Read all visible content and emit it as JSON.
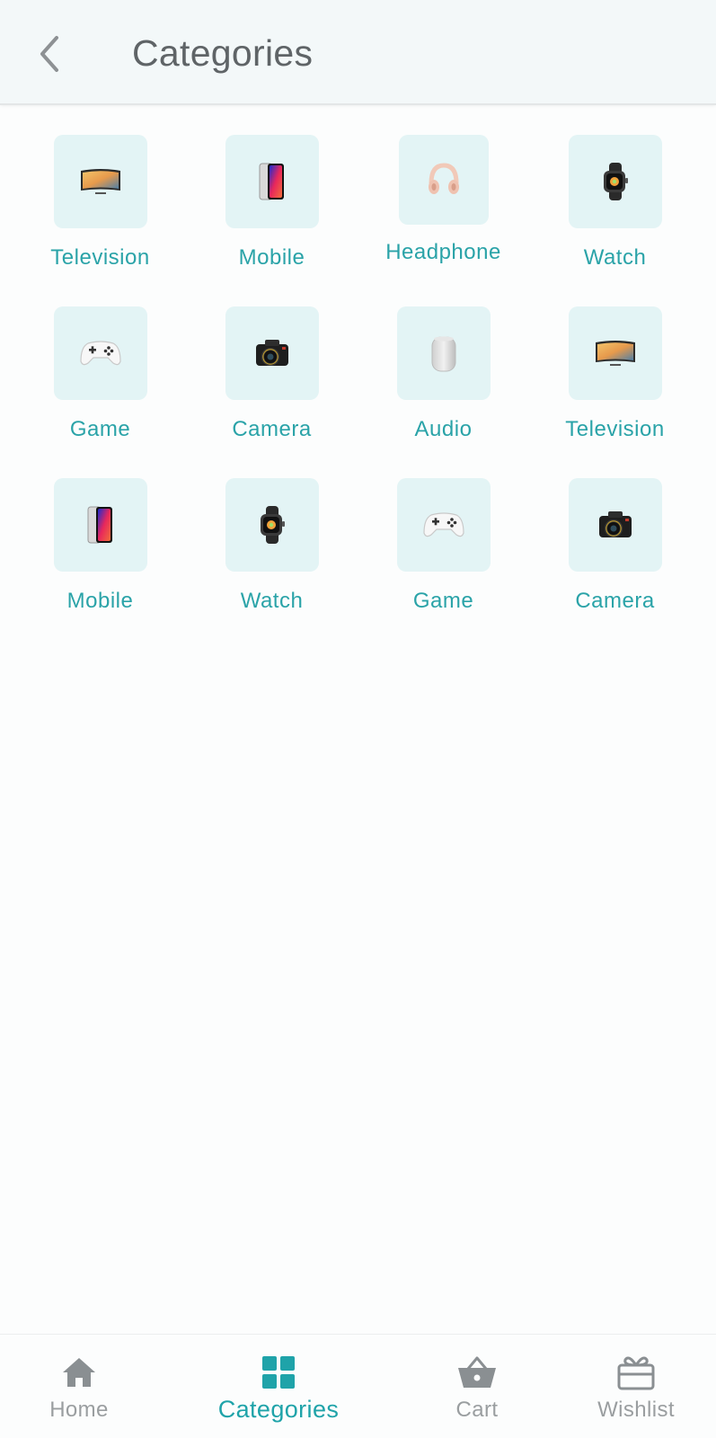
{
  "header": {
    "title": "Categories"
  },
  "categories": [
    {
      "label": "Television",
      "icon": "television-icon"
    },
    {
      "label": "Mobile",
      "icon": "mobile-icon"
    },
    {
      "label": "Headphone",
      "icon": "headphone-icon"
    },
    {
      "label": "Watch",
      "icon": "watch-icon"
    },
    {
      "label": "Game",
      "icon": "game-controller-icon"
    },
    {
      "label": "Camera",
      "icon": "camera-icon"
    },
    {
      "label": "Audio",
      "icon": "speaker-icon"
    },
    {
      "label": "Television",
      "icon": "television-icon"
    },
    {
      "label": "Mobile",
      "icon": "mobile-icon"
    },
    {
      "label": "Watch",
      "icon": "watch-icon"
    },
    {
      "label": "Game",
      "icon": "game-controller-icon"
    },
    {
      "label": "Camera",
      "icon": "camera-icon"
    }
  ],
  "bottom_nav": {
    "items": [
      {
        "label": "Home",
        "icon": "home-icon",
        "active": false
      },
      {
        "label": "Categories",
        "icon": "categories-grid-icon",
        "active": true
      },
      {
        "label": "Cart",
        "icon": "cart-basket-icon",
        "active": false
      },
      {
        "label": "Wishlist",
        "icon": "gift-icon",
        "active": false
      }
    ]
  },
  "colors": {
    "accent": "#1fa3a9",
    "tile_background": "#e3f4f5",
    "header_background": "#f3f8f9",
    "inactive": "#9a9ea0"
  }
}
